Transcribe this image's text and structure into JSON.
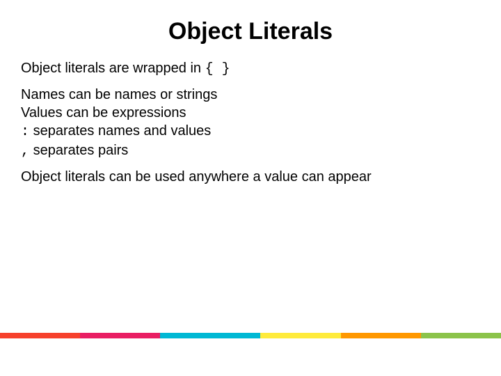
{
  "title": "Object Literals",
  "lines": {
    "l0_pre": "Object literals are wrapped in ",
    "l0_code": "{ }",
    "l1": "Names can be names or strings",
    "l2": "Values can be expressions",
    "l3_code": ":",
    "l3_post": " separates names and values",
    "l4_code": ",",
    "l4_post": " separates pairs",
    "l5": "Object literals can be used anywhere a value can appear"
  },
  "accent_colors": [
    "#f6402c",
    "#e91e63",
    "#00b8d4",
    "#ffeb3b",
    "#ff9800",
    "#8bc34a"
  ]
}
